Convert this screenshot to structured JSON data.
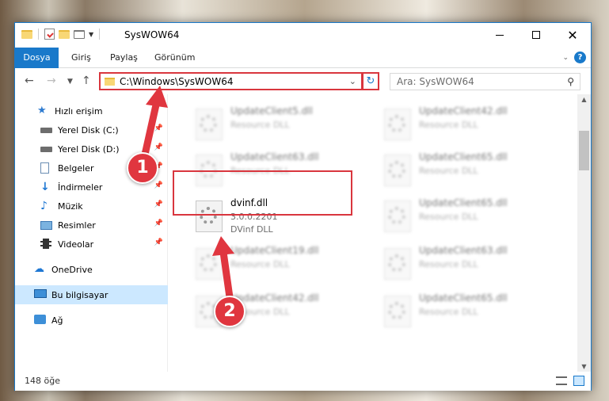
{
  "window": {
    "title": "SysWOW64"
  },
  "ribbon": {
    "tabs": [
      "Dosya",
      "Giriş",
      "Paylaş",
      "Görünüm"
    ],
    "help": "?"
  },
  "address": {
    "path": "C:\\Windows\\SysWOW64",
    "search_placeholder": "Ara: SysWOW64"
  },
  "nav": {
    "items": [
      {
        "label": "Hızlı erişim",
        "icon": "star-icon"
      },
      {
        "label": "Yerel Disk (C:)",
        "icon": "disk-icon"
      },
      {
        "label": "Yerel Disk (D:)",
        "icon": "disk-icon"
      },
      {
        "label": "Belgeler",
        "icon": "documents-icon"
      },
      {
        "label": "İndirmeler",
        "icon": "downloads-icon"
      },
      {
        "label": "Müzik",
        "icon": "music-icon"
      },
      {
        "label": "Resimler",
        "icon": "pictures-icon"
      },
      {
        "label": "Videolar",
        "icon": "videos-icon"
      },
      {
        "label": "OneDrive",
        "icon": "onedrive-icon"
      },
      {
        "label": "Bu bilgisayar",
        "icon": "this-pc-icon"
      },
      {
        "label": "Ağ",
        "icon": "network-icon"
      }
    ]
  },
  "files": [
    {
      "name": "UpdateClient5.dll",
      "line1": "Resource DLL",
      "line2": ""
    },
    {
      "name": "UpdateClient42.dll",
      "line1": "Resource DLL",
      "line2": ""
    },
    {
      "name": "UpdateClient63.dll",
      "line1": "Resource DLL",
      "line2": ""
    },
    {
      "name": "UpdateClient65.dll",
      "line1": "Resource DLL",
      "line2": ""
    },
    {
      "name": "dvinf.dll",
      "line1": "3.0.0.2201",
      "line2": "DVinf DLL"
    },
    {
      "name": "UpdateClient65.dll",
      "line1": "Resource DLL",
      "line2": ""
    },
    {
      "name": "UpdateClient19.dll",
      "line1": "Resource DLL",
      "line2": ""
    },
    {
      "name": "UpdateClient63.dll",
      "line1": "Resource DLL",
      "line2": ""
    },
    {
      "name": "UpdateClient42.dll",
      "line1": "Resource DLL",
      "line2": ""
    },
    {
      "name": "UpdateClient65.dll",
      "line1": "Resource DLL",
      "line2": ""
    }
  ],
  "status": {
    "count": "148 öğe"
  },
  "annotations": {
    "badge1": "1",
    "badge2": "2"
  },
  "colors": {
    "accent": "#1979ca",
    "highlight": "#d9363e",
    "selected": "#cce8ff"
  }
}
